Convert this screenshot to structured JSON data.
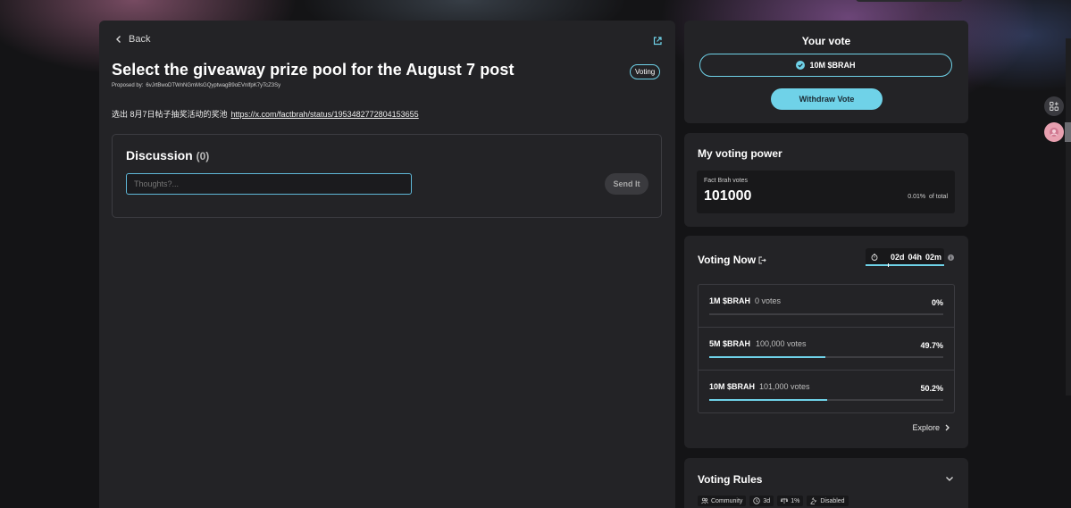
{
  "proposal": {
    "back_label": "Back",
    "title": "Select the giveaway prize pool for the August 7 post",
    "status_badge": "Voting",
    "proposer_prefix": "Proposed by:",
    "proposer_address": "6vJrtBwoDTWnNGmMsGQyptwagB9oEVnlfpK7yTcZ3Sy",
    "description": "选出 8月7日帖子抽奖活动的奖池",
    "link": "https://x.com/factbrah/status/1953482772804153655"
  },
  "discussion": {
    "title": "Discussion",
    "count": "(0)",
    "placeholder": "Thoughts?...",
    "send_label": "Send It"
  },
  "your_vote": {
    "title": "Your vote",
    "choice": "10M $BRAH",
    "withdraw_label": "Withdraw Vote"
  },
  "voting_power": {
    "title": "My voting power",
    "label": "Fact Brah votes",
    "value": "101000",
    "pct": "0.01%",
    "pct_suffix": "of total"
  },
  "voting_now": {
    "title": "Voting Now",
    "timer_days": "02d",
    "timer_hours": "04h",
    "timer_minutes": "02m",
    "options": [
      {
        "label": "1M $BRAH",
        "votes": "0 votes",
        "pct": "0%",
        "fill": 0
      },
      {
        "label": "5M $BRAH",
        "votes": "100,000 votes",
        "pct": "49.7%",
        "fill": 0.497
      },
      {
        "label": "10M $BRAH",
        "votes": "101,000 votes",
        "pct": "50.2%",
        "fill": 0.502
      }
    ],
    "explore_label": "Explore"
  },
  "rules": {
    "title": "Voting Rules",
    "tags": [
      {
        "label": "Community",
        "icon": "people-icon"
      },
      {
        "label": "3d",
        "icon": "clock-icon"
      },
      {
        "label": "1%",
        "icon": "scale-icon"
      },
      {
        "label": "Disabled",
        "icon": "gavel-icon"
      }
    ]
  },
  "colors": {
    "accent": "#6fd2e8",
    "panel": "#232326",
    "background": "#141416"
  }
}
